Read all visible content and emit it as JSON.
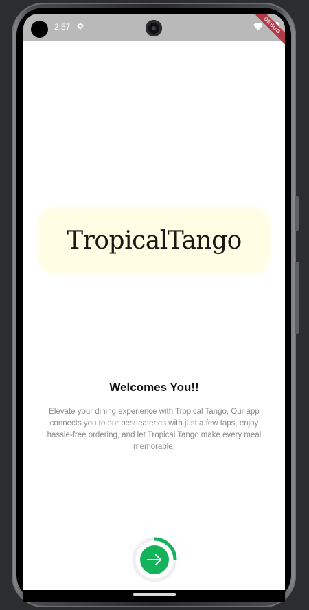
{
  "status_bar": {
    "time": "2:57",
    "icons": [
      "gear-icon",
      "wifi-icon",
      "battery-icon"
    ],
    "debug_label": "DEBUG"
  },
  "logo": {
    "text": "TropicalTango",
    "background": "#fffde4"
  },
  "welcome": {
    "title": "Welcomes You!!",
    "body": "Elevate your dining experience with Tropical Tango, Our app connects you to our best  eateries with just a few taps, enjoy hassle-free ordering, and let Tropical Tango make every meal memorable."
  },
  "next": {
    "icon": "arrow-right-icon",
    "accent": "#14b35a",
    "progress": 0.25
  }
}
